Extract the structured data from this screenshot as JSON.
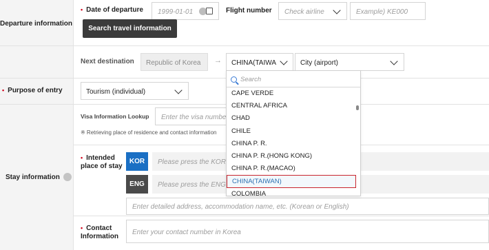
{
  "departure": {
    "section_label": "Departure information",
    "date_label": "Date of departure",
    "date_placeholder": "1999-01-01",
    "flight_label": "Flight number",
    "airline_placeholder": "Check airline",
    "flight_placeholder": "Example) KE000",
    "search_button": "Search travel information"
  },
  "next_destination": {
    "label": "Next destination",
    "from_value": "Republic of Korea",
    "arrow": "→",
    "country_value": "CHINA(TAIWA",
    "city_value": "City (airport)"
  },
  "purpose": {
    "label": "Purpose of entry",
    "value": "Tourism (individual)"
  },
  "visa": {
    "label": "Visa Information Lookup",
    "placeholder": "Enter the visa number",
    "note": "※ Retrieving place of residence and contact information"
  },
  "stay": {
    "section_label": "Stay information",
    "intended_label_1": "Intended",
    "intended_label_2": "place of stay",
    "kor_badge": "KOR",
    "kor_placeholder": "Please press the KOR bu",
    "eng_badge": "ENG",
    "eng_placeholder": "Please press the ENG bu",
    "detail_placeholder": "Enter detailed address, accommodation name, etc. (Korean or English)",
    "contact_label_1": "Contact",
    "contact_label_2": "Information",
    "contact_placeholder": "Enter your contact number in Korea"
  },
  "dropdown": {
    "search_placeholder": "Search",
    "items": [
      "CAPE VERDE",
      "CENTRAL AFRICA",
      "CHAD",
      "CHILE",
      "CHINA P. R.",
      "CHINA P. R.(HONG KONG)",
      "CHINA P. R.(MACAO)",
      "CHINA(TAIWAN)",
      "COLOMBIA"
    ],
    "selected_index": 7
  },
  "colors": {
    "required": "#d0021b",
    "kor_badge": "#1a6fc4",
    "eng_badge": "#4a4a4a",
    "selected_text": "#2a6fb0",
    "selected_border": "#c8232c",
    "search_icon": "#3a7bd5"
  }
}
